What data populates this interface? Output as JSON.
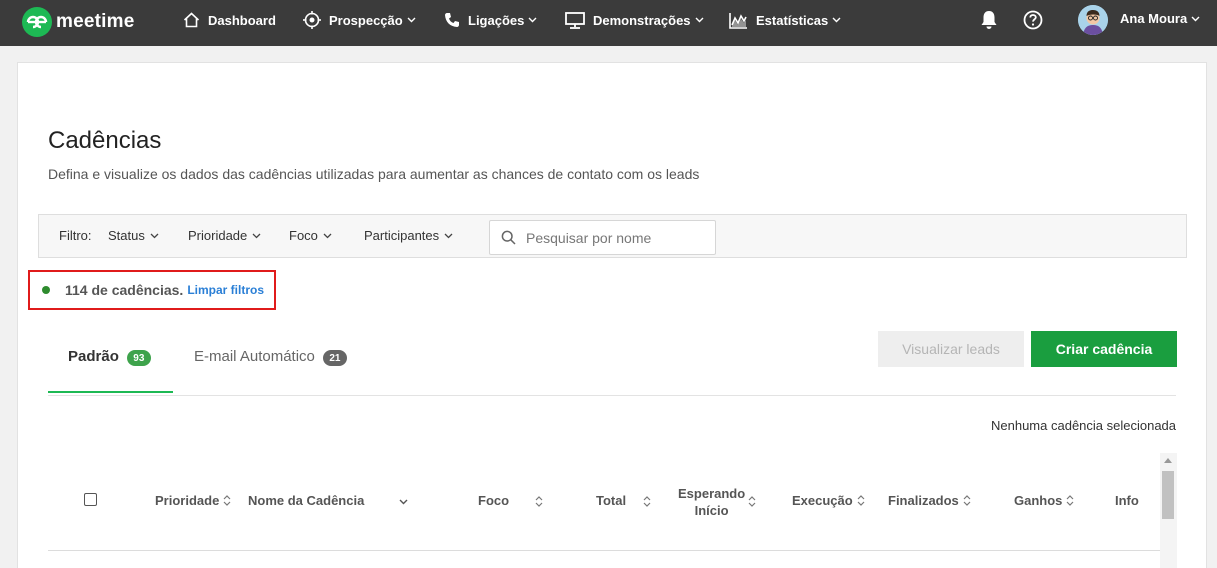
{
  "app": {
    "logo_text": "meetime"
  },
  "nav": {
    "items": [
      {
        "label": "Dashboard",
        "icon": "home-icon",
        "has_dropdown": false
      },
      {
        "label": "Prospecção",
        "icon": "crosshair-icon",
        "has_dropdown": true
      },
      {
        "label": "Ligações",
        "icon": "phone-icon",
        "has_dropdown": true
      },
      {
        "label": "Demonstrações",
        "icon": "monitor-icon",
        "has_dropdown": true
      },
      {
        "label": "Estatísticas",
        "icon": "chart-icon",
        "has_dropdown": true
      }
    ],
    "user_name": "Ana Moura"
  },
  "page": {
    "title": "Cadências",
    "subtitle": "Defina e visualize os dados das cadências utilizadas para aumentar as chances de contato com os leads"
  },
  "filters": {
    "label": "Filtro:",
    "dropdowns": [
      "Status",
      "Prioridade",
      "Foco",
      "Participantes"
    ],
    "search_placeholder": "Pesquisar por nome"
  },
  "results": {
    "count_text": "114 de cadências.",
    "clear_link": "Limpar filtros"
  },
  "buttons": {
    "view_leads": "Visualizar leads",
    "create": "Criar cadência"
  },
  "tabs": [
    {
      "label": "Padrão",
      "count": "93",
      "active": true
    },
    {
      "label": "E-mail Automático",
      "count": "21",
      "active": false
    }
  ],
  "selection_info": "Nenhuma cadência selecionada",
  "table": {
    "columns": [
      "Prioridade",
      "Nome da Cadência",
      "Foco",
      "Total",
      "Esperando",
      "Início",
      "Execução",
      "Finalizados",
      "Ganhos",
      "Info"
    ]
  },
  "colors": {
    "navbar": "#3b3b3b",
    "brand_green": "#1db954",
    "primary_button": "#1a9e3f",
    "link": "#2a7fd6",
    "highlight_border": "#e01b1b"
  }
}
